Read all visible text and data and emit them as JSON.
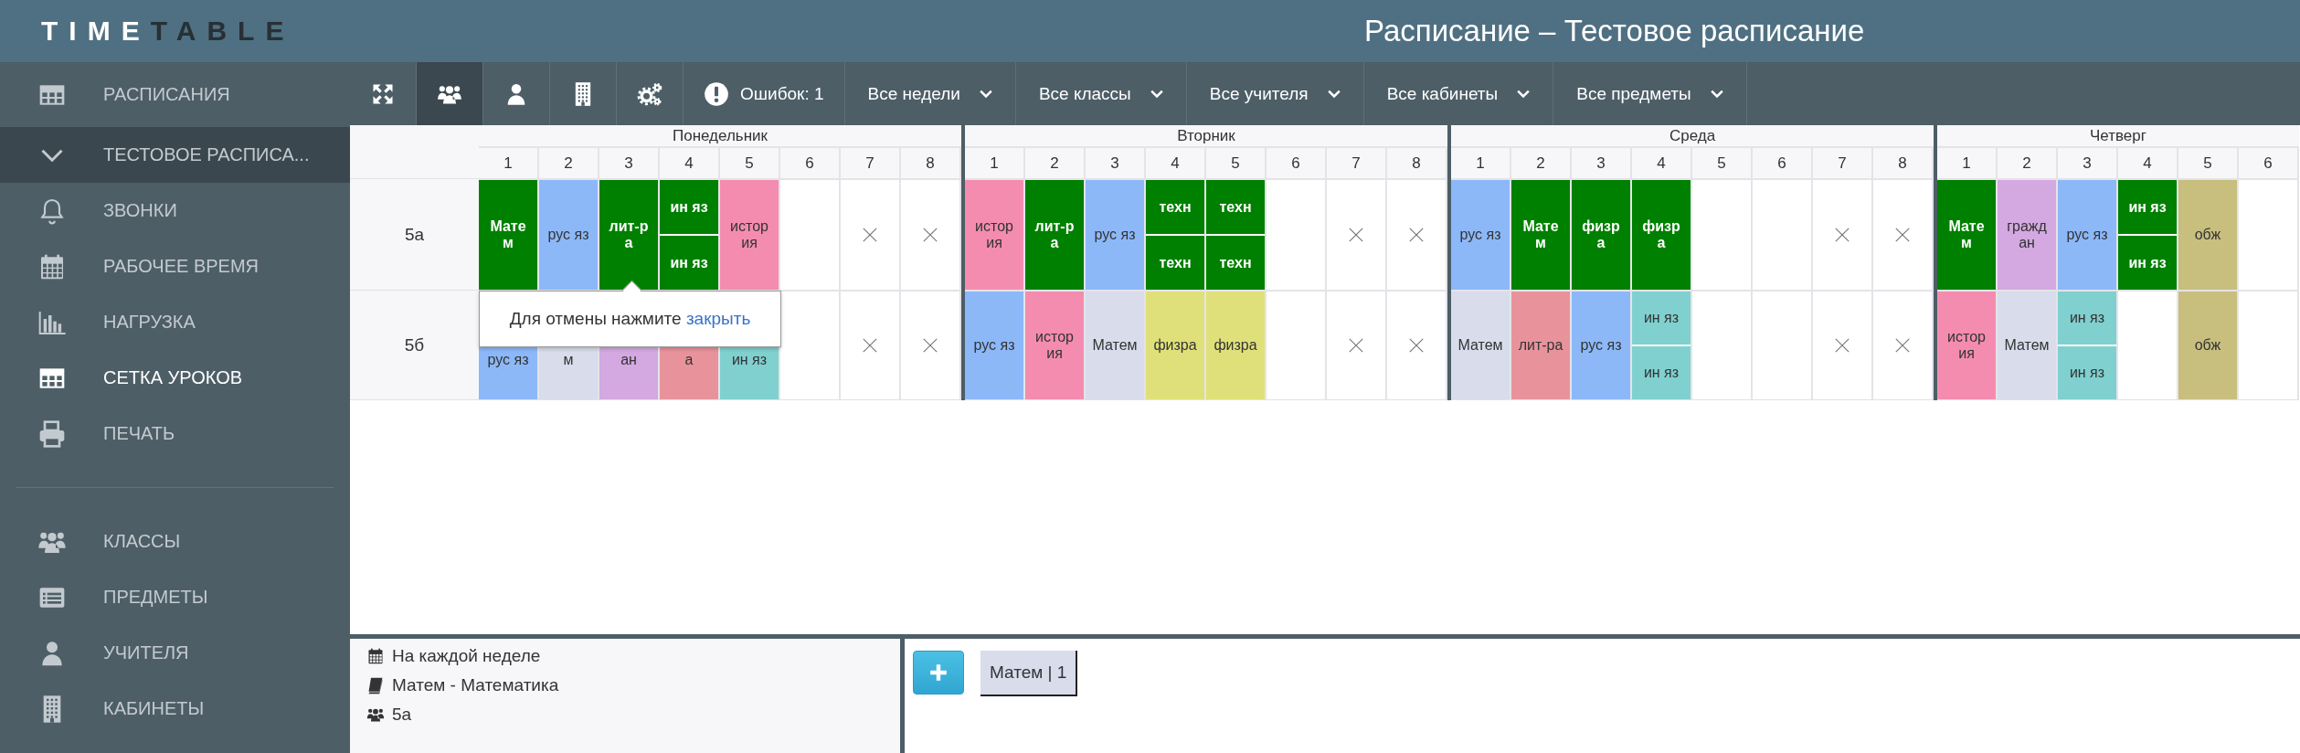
{
  "header": {
    "logo": {
      "primary": "TIME",
      "secondary": "TABLE"
    },
    "title": "Расписание – Тестовое расписание"
  },
  "sidebar": {
    "sections": [
      [
        {
          "kind": "item",
          "label": "РАСПИСАНИЯ",
          "selected": false
        },
        {
          "kind": "group",
          "label": "ТЕСТОВОЕ РАСПИСА...",
          "expanded": true,
          "selected": false
        },
        {
          "kind": "item",
          "label": "ЗВОНКИ",
          "selected": false
        },
        {
          "kind": "item",
          "label": "РАБОЧЕЕ ВРЕМЯ",
          "selected": false
        },
        {
          "kind": "item",
          "label": "НАГРУЗКА",
          "selected": false
        },
        {
          "kind": "item",
          "label": "СЕТКА УРОКОВ",
          "selected": true
        },
        {
          "kind": "item",
          "label": "ПЕЧАТЬ",
          "selected": false
        }
      ],
      [
        {
          "kind": "item",
          "label": "КЛАССЫ",
          "selected": false
        },
        {
          "kind": "item",
          "label": "ПРЕДМЕТЫ",
          "selected": false
        },
        {
          "kind": "item",
          "label": "УЧИТЕЛЯ",
          "selected": false
        },
        {
          "kind": "item",
          "label": "КАБИНЕТЫ",
          "selected": false
        }
      ]
    ]
  },
  "toolbar": {
    "view_buttons": [
      {
        "selected": false
      },
      {
        "selected": true
      },
      {
        "selected": false
      },
      {
        "selected": false
      },
      {
        "selected": false
      }
    ],
    "errors": "Ошибок: 1",
    "filters": [
      "Все недели",
      "Все классы",
      "Все учителя",
      "Все кабинеты",
      "Все предметы"
    ]
  },
  "grid": {
    "days": [
      {
        "name": "Понедельник",
        "periods": [
          "1",
          "2",
          "3",
          "4",
          "5",
          "6",
          "7",
          "8"
        ]
      },
      {
        "name": "Вторник",
        "periods": [
          "1",
          "2",
          "3",
          "4",
          "5",
          "6",
          "7",
          "8"
        ]
      },
      {
        "name": "Среда",
        "periods": [
          "1",
          "2",
          "3",
          "4",
          "5",
          "6",
          "7",
          "8"
        ]
      },
      {
        "name": "Четверг",
        "periods": [
          "1",
          "2",
          "3",
          "4",
          "5",
          "6"
        ]
      }
    ],
    "rows": [
      {
        "class": "5а",
        "days": [
          [
            {
              "kind": "lesson",
              "text": "Матем",
              "color": "#008000",
              "highlighted": true
            },
            {
              "kind": "lesson",
              "text": "рус яз",
              "color": "#8cb8f8",
              "highlighted": false
            },
            {
              "kind": "lesson",
              "text": "лит-ра",
              "color": "#008000",
              "highlighted": true
            },
            {
              "kind": "split",
              "halves": [
                {
                  "text": "ин яз",
                  "color": "#008000",
                  "highlighted": true
                },
                {
                  "text": "ин яз",
                  "color": "#008000",
                  "highlighted": true
                }
              ]
            },
            {
              "kind": "lesson",
              "text": "история",
              "color": "#f48cb0",
              "highlighted": false
            },
            {
              "kind": "empty"
            },
            {
              "kind": "blocked"
            },
            {
              "kind": "blocked"
            }
          ],
          [
            {
              "kind": "lesson",
              "text": "история",
              "color": "#f48cb0",
              "highlighted": false
            },
            {
              "kind": "lesson",
              "text": "лит-ра",
              "color": "#008000",
              "highlighted": true
            },
            {
              "kind": "lesson",
              "text": "рус яз",
              "color": "#8cb8f8",
              "highlighted": false
            },
            {
              "kind": "split",
              "halves": [
                {
                  "text": "техн",
                  "color": "#008000",
                  "highlighted": true
                },
                {
                  "text": "техн",
                  "color": "#008000",
                  "highlighted": true
                }
              ]
            },
            {
              "kind": "split",
              "halves": [
                {
                  "text": "техн",
                  "color": "#008000",
                  "highlighted": true
                },
                {
                  "text": "техн",
                  "color": "#008000",
                  "highlighted": true
                }
              ]
            },
            {
              "kind": "empty"
            },
            {
              "kind": "blocked"
            },
            {
              "kind": "blocked"
            }
          ],
          [
            {
              "kind": "lesson",
              "text": "рус яз",
              "color": "#8cb8f8",
              "highlighted": false
            },
            {
              "kind": "lesson",
              "text": "Матем",
              "color": "#008000",
              "highlighted": true
            },
            {
              "kind": "lesson",
              "text": "физра",
              "color": "#008000",
              "highlighted": true
            },
            {
              "kind": "lesson",
              "text": "физра",
              "color": "#008000",
              "highlighted": true
            },
            {
              "kind": "empty"
            },
            {
              "kind": "empty"
            },
            {
              "kind": "blocked"
            },
            {
              "kind": "blocked"
            }
          ],
          [
            {
              "kind": "lesson",
              "text": "Матем",
              "color": "#008000",
              "highlighted": true
            },
            {
              "kind": "lesson",
              "text": "граждан",
              "color": "#d4a8e0",
              "highlighted": false
            },
            {
              "kind": "lesson",
              "text": "рус яз",
              "color": "#8cb8f8",
              "highlighted": false
            },
            {
              "kind": "split",
              "halves": [
                {
                  "text": "ин яз",
                  "color": "#008000",
                  "highlighted": true
                },
                {
                  "text": "ин яз",
                  "color": "#008000",
                  "highlighted": true
                }
              ]
            },
            {
              "kind": "lesson",
              "text": "обж",
              "color": "#c8be7e",
              "highlighted": false
            },
            {
              "kind": "empty"
            }
          ]
        ]
      },
      {
        "class": "5б",
        "days": [
          [
            {
              "kind": "lesson",
              "text": "рус яз",
              "color": "#8cb8f8",
              "highlighted": false,
              "covered": true
            },
            {
              "kind": "lesson",
              "text": "м",
              "color": "#d8dceb",
              "highlighted": false,
              "covered": true
            },
            {
              "kind": "lesson",
              "text": "ан",
              "color": "#d4a8e0",
              "highlighted": false,
              "covered": true
            },
            {
              "kind": "lesson",
              "text": "а",
              "color": "#e8939c",
              "highlighted": false,
              "covered": true
            },
            {
              "kind": "lesson",
              "text": "ин яз",
              "color": "#80d0d0",
              "highlighted": false,
              "covered": true
            },
            {
              "kind": "empty"
            },
            {
              "kind": "blocked"
            },
            {
              "kind": "blocked"
            }
          ],
          [
            {
              "kind": "lesson",
              "text": "рус яз",
              "color": "#8cb8f8",
              "highlighted": false
            },
            {
              "kind": "lesson",
              "text": "история",
              "color": "#f48cb0",
              "highlighted": false
            },
            {
              "kind": "lesson",
              "text": "Матем",
              "color": "#d8dceb",
              "highlighted": false
            },
            {
              "kind": "lesson",
              "text": "физра",
              "color": "#e0e07a",
              "highlighted": false
            },
            {
              "kind": "lesson",
              "text": "физра",
              "color": "#e0e07a",
              "highlighted": false
            },
            {
              "kind": "empty"
            },
            {
              "kind": "blocked"
            },
            {
              "kind": "blocked"
            }
          ],
          [
            {
              "kind": "lesson",
              "text": "Матем",
              "color": "#d8dceb",
              "highlighted": false
            },
            {
              "kind": "lesson",
              "text": "лит-ра",
              "color": "#e8939c",
              "highlighted": false
            },
            {
              "kind": "lesson",
              "text": "рус яз",
              "color": "#8cb8f8",
              "highlighted": false
            },
            {
              "kind": "split",
              "halves": [
                {
                  "text": "ин яз",
                  "color": "#80d0d0",
                  "highlighted": false
                },
                {
                  "text": "ин яз",
                  "color": "#80d0d0",
                  "highlighted": false
                }
              ]
            },
            {
              "kind": "empty"
            },
            {
              "kind": "empty"
            },
            {
              "kind": "blocked"
            },
            {
              "kind": "blocked"
            }
          ],
          [
            {
              "kind": "lesson",
              "text": "история",
              "color": "#f48cb0",
              "highlighted": false
            },
            {
              "kind": "lesson",
              "text": "Матем",
              "color": "#d8dceb",
              "highlighted": false
            },
            {
              "kind": "split",
              "halves": [
                {
                  "text": "ин яз",
                  "color": "#80d0d0",
                  "highlighted": false
                },
                {
                  "text": "ин яз",
                  "color": "#80d0d0",
                  "highlighted": false
                }
              ]
            },
            {
              "kind": "empty"
            },
            {
              "kind": "lesson",
              "text": "обж",
              "color": "#c8be7e",
              "highlighted": false
            },
            {
              "kind": "empty"
            }
          ]
        ]
      }
    ]
  },
  "tooltip": {
    "text": "Для отмены нажмите",
    "link": "закрыть"
  },
  "details": {
    "lines": [
      {
        "text": "На каждой неделе"
      },
      {
        "text": "Матем - Математика"
      },
      {
        "text": "5а"
      }
    ]
  },
  "lessons": [
    "Матем | 1"
  ]
}
